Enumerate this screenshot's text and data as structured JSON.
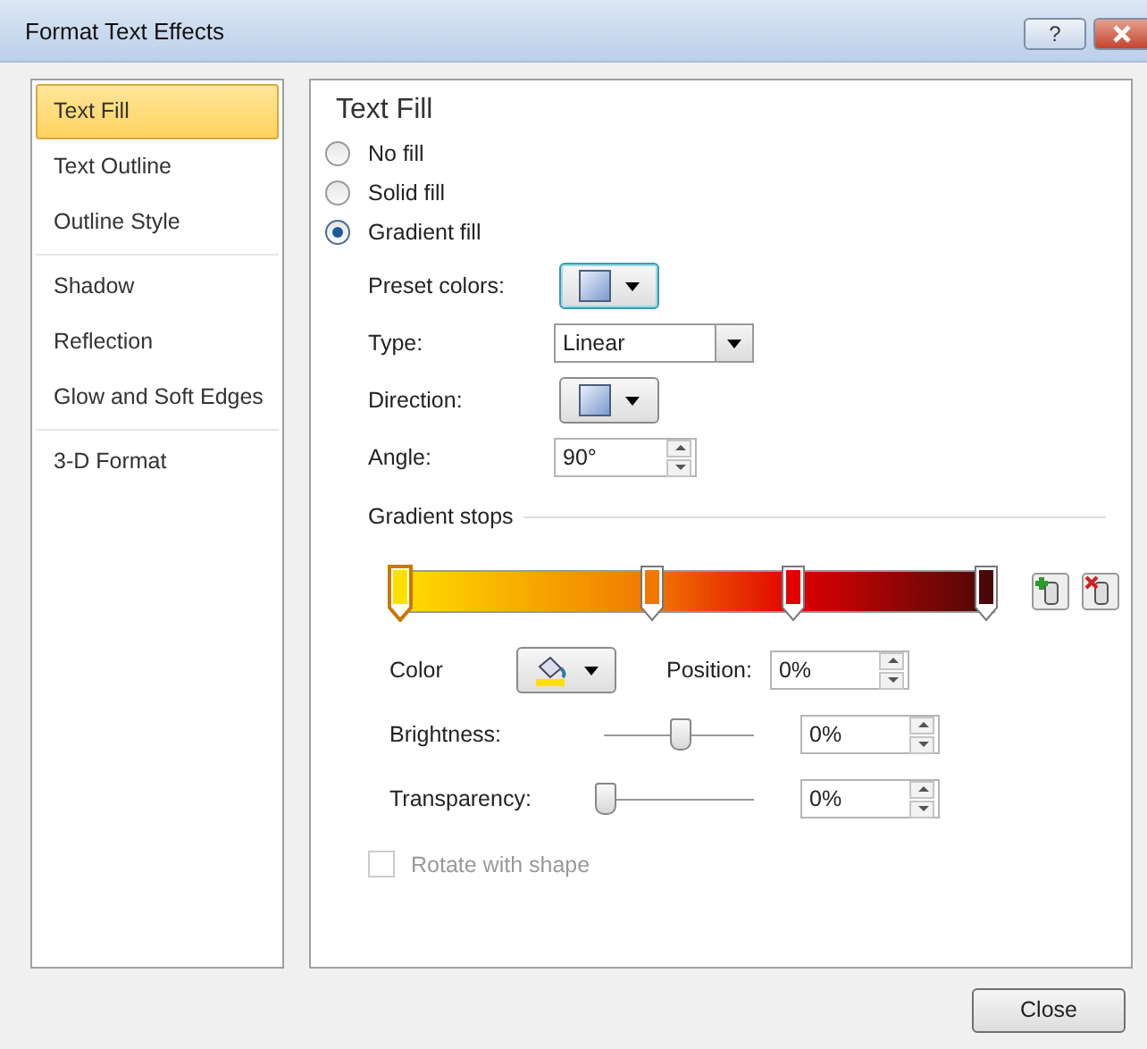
{
  "window": {
    "title": "Format Text Effects",
    "help_button": "?"
  },
  "sidebar": {
    "groups": [
      [
        {
          "label": "Text Fill",
          "selected": true
        },
        {
          "label": "Text Outline",
          "selected": false
        },
        {
          "label": "Outline Style",
          "selected": false
        }
      ],
      [
        {
          "label": "Shadow",
          "selected": false
        },
        {
          "label": "Reflection",
          "selected": false
        },
        {
          "label": "Glow and Soft Edges",
          "selected": false
        }
      ],
      [
        {
          "label": "3-D Format",
          "selected": false
        }
      ]
    ]
  },
  "panel": {
    "title": "Text Fill",
    "fill_options": [
      {
        "label": "No fill",
        "selected": false
      },
      {
        "label": "Solid fill",
        "selected": false
      },
      {
        "label": "Gradient fill",
        "selected": true
      }
    ],
    "preset_colors": {
      "label": "Preset colors:"
    },
    "type": {
      "label": "Type:",
      "value": "Linear"
    },
    "direction": {
      "label": "Direction:"
    },
    "angle": {
      "label": "Angle:",
      "value": "90°"
    },
    "gradient_stops": {
      "label": "Gradient stops",
      "stops": [
        {
          "level": 0.0,
          "color": "#ffe000",
          "selected": true
        },
        {
          "level": 0.43,
          "color": "#f07800",
          "selected": false
        },
        {
          "level": 0.67,
          "color": "#e00000",
          "selected": false
        },
        {
          "level": 1.0,
          "color": "#4a0808",
          "selected": false
        }
      ]
    },
    "color": {
      "label": "Color"
    },
    "position": {
      "label": "Position:",
      "value": "0%"
    },
    "sliders": [
      {
        "label": "Brightness:",
        "level": 0.5,
        "value": "0%"
      },
      {
        "label": "Transparency:",
        "level": 0.0,
        "value": "0%"
      }
    ],
    "rotate_with_shape": {
      "label": "Rotate with shape",
      "checked": false,
      "disabled": true
    }
  },
  "buttons": [
    "Close"
  ]
}
